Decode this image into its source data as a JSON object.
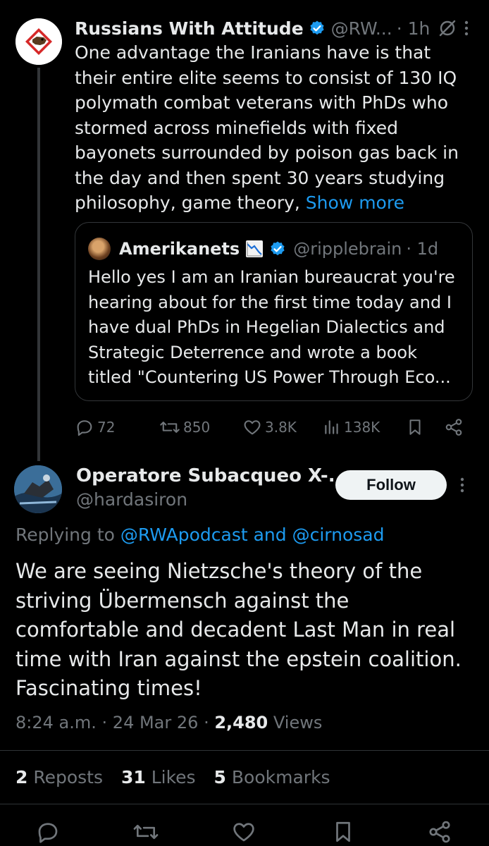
{
  "parent": {
    "name": "Russians With Attitude",
    "handle": "@RW...",
    "time": "· 1h",
    "text": "One advantage the Iranians have is that their entire elite seems to consist of 130 IQ polymath combat veterans with PhDs who stormed across minefields with fixed bayonets surrounded by poison gas back in the day and then spent 30 years studying philosophy, game theory,",
    "show_more": "Show more",
    "quote": {
      "name": "Amerikanets",
      "emoji": "chart-decreasing-icon",
      "handle": "@ripplebrain",
      "time": "· 1d",
      "text": "Hello yes I am an Iranian bureaucrat you're hearing about for the first time today and I have dual PhDs in Hegelian Dialectics and Strategic Deterrence and wrote a book titled \"Countering US Power Through Eco..."
    },
    "actions": {
      "replies": "72",
      "reposts": "850",
      "likes": "3.8K",
      "views": "138K"
    }
  },
  "reply": {
    "name": "Operatore Subacqueo X-...",
    "handle": "@hardasiron",
    "follow_label": "Follow",
    "replying_prefix": "Replying to",
    "replying_mentions": "@RWApodcast and @cirnosad",
    "text": "We are seeing Nietzsche's theory of the striving Übermensch against the comfortable and decadent Last Man in real time with Iran against the epstein coalition. Fascinating times!",
    "time": "8:24 a.m.",
    "date": "24 Mar 26",
    "views_count": "2,480",
    "views_label": "Views",
    "stats": {
      "reposts_count": "2",
      "reposts_label": "Reposts",
      "likes_count": "31",
      "likes_label": "Likes",
      "bookmarks_count": "5",
      "bookmarks_label": "Bookmarks"
    }
  },
  "colors": {
    "background": "#000000",
    "text": "#e7e9ea",
    "secondary": "#71767b",
    "accent": "#1d9bf0",
    "border": "#333639"
  }
}
